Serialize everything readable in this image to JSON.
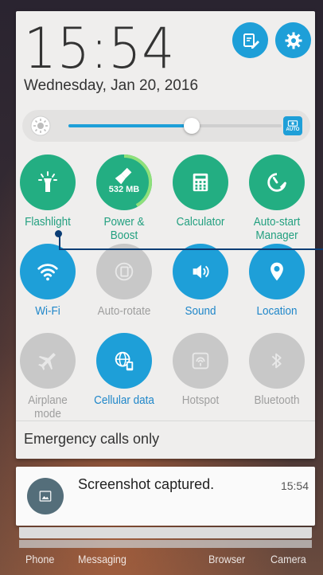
{
  "header": {
    "time": "15:54",
    "date": "Wednesday, Jan 20, 2016",
    "edit_button_icon": "edit-icon",
    "settings_button_icon": "gear-icon"
  },
  "brightness": {
    "level_fraction": 0.58,
    "auto_label": "AUTO",
    "auto_icon": "auto-brightness-icon"
  },
  "tiles": [
    {
      "label": "Flashlight",
      "icon": "flashlight-icon",
      "state": "on"
    },
    {
      "label": "Power &\nBoost",
      "icon": "broom-icon",
      "state": "on",
      "badge": "532 MB",
      "ring_fraction": 0.42
    },
    {
      "label": "Calculator",
      "icon": "calculator-icon",
      "state": "on"
    },
    {
      "label": "Auto-start\nManager",
      "icon": "autostart-icon",
      "state": "on"
    },
    {
      "label": "Wi-Fi",
      "icon": "wifi-icon",
      "state": "on"
    },
    {
      "label": "Auto-rotate",
      "icon": "rotate-icon",
      "state": "off"
    },
    {
      "label": "Sound",
      "icon": "sound-icon",
      "state": "on"
    },
    {
      "label": "Location",
      "icon": "location-icon",
      "state": "on"
    },
    {
      "label": "Airplane\nmode",
      "icon": "airplane-icon",
      "state": "off"
    },
    {
      "label": "Cellular data",
      "icon": "cellular-data-icon",
      "state": "on"
    },
    {
      "label": "Hotspot",
      "icon": "hotspot-icon",
      "state": "off"
    },
    {
      "label": "Bluetooth",
      "icon": "bluetooth-icon",
      "state": "off"
    }
  ],
  "status_text": "Emergency calls only",
  "notification": {
    "title": "Screenshot captured.",
    "time": "15:54",
    "icon": "image-icon"
  },
  "dock": {
    "items": [
      "Phone",
      "Messaging",
      "Browser",
      "Camera"
    ]
  },
  "colors": {
    "accent_blue": "#1e9fd8",
    "accent_green": "#23ae82",
    "off_gray": "#c8c8c8"
  }
}
